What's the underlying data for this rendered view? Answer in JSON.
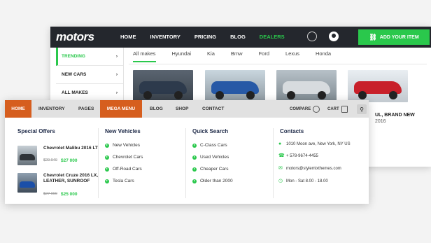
{
  "app": {
    "logo": "motors"
  },
  "top_nav": {
    "items": [
      "HOME",
      "INVENTORY",
      "PRICING",
      "BLOG",
      "DEALERS"
    ],
    "active_index": 4
  },
  "add_item_label": "ADD YOUR ITEM",
  "sidebar": {
    "items": [
      {
        "label": "TRENDING",
        "active": true
      },
      {
        "label": "NEW CARS",
        "active": false
      },
      {
        "label": "ALL MAKES",
        "active": false
      }
    ]
  },
  "make_filters": {
    "items": [
      "All makes",
      "Hyundai",
      "Kia",
      "Bmw",
      "Ford",
      "Lexus",
      "Honda"
    ],
    "active_index": 0
  },
  "car_caption": [
    "UL, BRAND NEW",
    "2016"
  ],
  "mega_menu": {
    "items": [
      "HOME",
      "INVENTORY",
      "PAGES",
      "MEGA MENU",
      "BLOG",
      "SHOP",
      "CONTACT"
    ],
    "compare_label": "COMPARE",
    "cart_label": "CART"
  },
  "special_offers": {
    "heading": "Special Offers",
    "items": [
      {
        "title": "Chevrolet Malibu 2016 LT",
        "old_price": "$29 940",
        "new_price": "$27 000"
      },
      {
        "title": "Chevrolet Cruze 2016 LX, LEATHER, SUNROOF",
        "old_price": "$27 000",
        "new_price": "$25 000"
      }
    ]
  },
  "new_vehicles": {
    "heading": "New Vehicles",
    "items": [
      "New Vehicles",
      "Chevrolet Cars",
      "Off-Road Cars",
      "Tesla Cars"
    ]
  },
  "quick_search": {
    "heading": "Quick Search",
    "items": [
      "C-Class Cars",
      "Used Vehicles",
      "Cheaper Cars",
      "Older than 2000"
    ]
  },
  "contacts": {
    "heading": "Contacts",
    "items": [
      {
        "icon": "location-icon",
        "text": "1010 Moon ave, New York, NY US"
      },
      {
        "icon": "phone-icon",
        "text": "+ 578-9674-4455"
      },
      {
        "icon": "mail-icon",
        "text": "motors@stylemixthemes.com"
      },
      {
        "icon": "clock-icon",
        "text": "Mon - Sat 8.00 - 18.00"
      }
    ]
  },
  "colors": {
    "accent": "#2ac84c",
    "menu_active": "#d65e1e",
    "header_dark": "#24272d"
  }
}
